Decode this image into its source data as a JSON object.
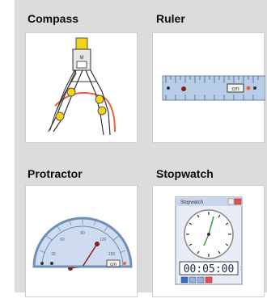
{
  "tools": [
    {
      "label": "Compass"
    },
    {
      "label": "Ruler",
      "unit_label": "cm"
    },
    {
      "label": "Protractor",
      "unit_label": "cm"
    },
    {
      "label": "Stopwatch",
      "window_title": "Stopwatch",
      "time": "00:05:00"
    }
  ],
  "colors": {
    "panel_bg": "#dcdcdc",
    "card_bg": "#ffffff",
    "ruler_blue": "#b8cde6",
    "protractor_blue": "#6f8fb8",
    "handle_yellow": "#f3d21c",
    "arc_red": "#f0603c",
    "hand_green": "#3aa33a",
    "hand_red": "#8c1a1a"
  },
  "icons": [
    "compass-icon",
    "ruler-icon",
    "protractor-icon",
    "stopwatch-icon",
    "play-icon",
    "pause-icon",
    "reset-icon",
    "close-icon"
  ]
}
